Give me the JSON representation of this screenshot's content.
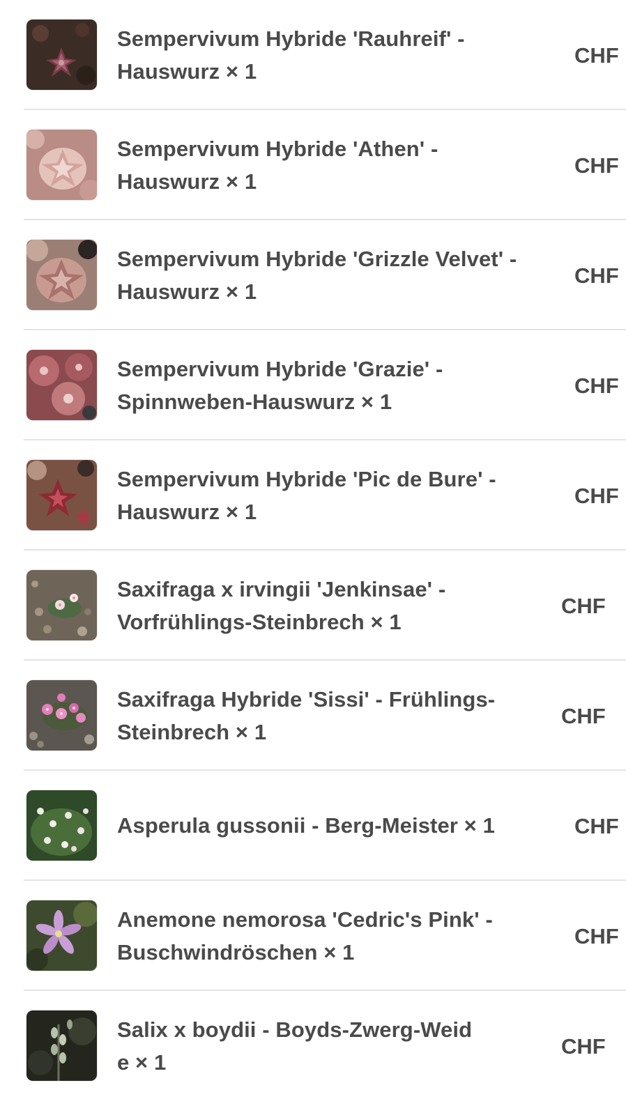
{
  "order_items": [
    {
      "line1": "Sempervivum Hybride 'Rauhreif' -",
      "line2": "Hauswurz × 1",
      "price": "CHF",
      "image": "sempervivum-dark-rosette"
    },
    {
      "line1": "Sempervivum Hybride 'Athen' -",
      "line2": "Hauswurz × 1",
      "price": "CHF",
      "image": "sempervivum-pink-rosette"
    },
    {
      "line1": "Sempervivum Hybride 'Grizzle Velvet' -",
      "line2": "Hauswurz × 1",
      "price": "CHF",
      "image": "sempervivum-velvet-rosette"
    },
    {
      "line1": "Sempervivum Hybride 'Grazie' -",
      "line2": "Spinnweben-Hauswurz × 1",
      "price": "CHF",
      "image": "sempervivum-cobweb-rosette"
    },
    {
      "line1": "Sempervivum Hybride 'Pic de Bure' -",
      "line2": "Hauswurz × 1",
      "price": "CHF",
      "image": "sempervivum-red-rosette"
    },
    {
      "line1": "Saxifraga x irvingii 'Jenkinsae' -",
      "line2": "Vorfrühlings-Steinbrech × 1",
      "price": "CHF",
      "image": "saxifraga-pale-flowers"
    },
    {
      "line1": "Saxifraga Hybride 'Sissi' - Frühlings-",
      "line2": "Steinbrech × 1",
      "price": "CHF",
      "image": "saxifraga-pink-flowers"
    },
    {
      "line1": "Asperula gussonii - Berg-Meister × 1",
      "line2": "",
      "price": "CHF",
      "image": "asperula-cushion"
    },
    {
      "line1": "Anemone nemorosa 'Cedric's Pink' -",
      "line2": "Buschwindröschen × 1",
      "price": "CHF",
      "image": "anemone-pink-flower"
    },
    {
      "line1": "Salix x boydii - Boyds-Zwerg-Weid",
      "line2": "e × 1",
      "price": "CHF",
      "image": "salix-dwarf-shrub"
    }
  ]
}
